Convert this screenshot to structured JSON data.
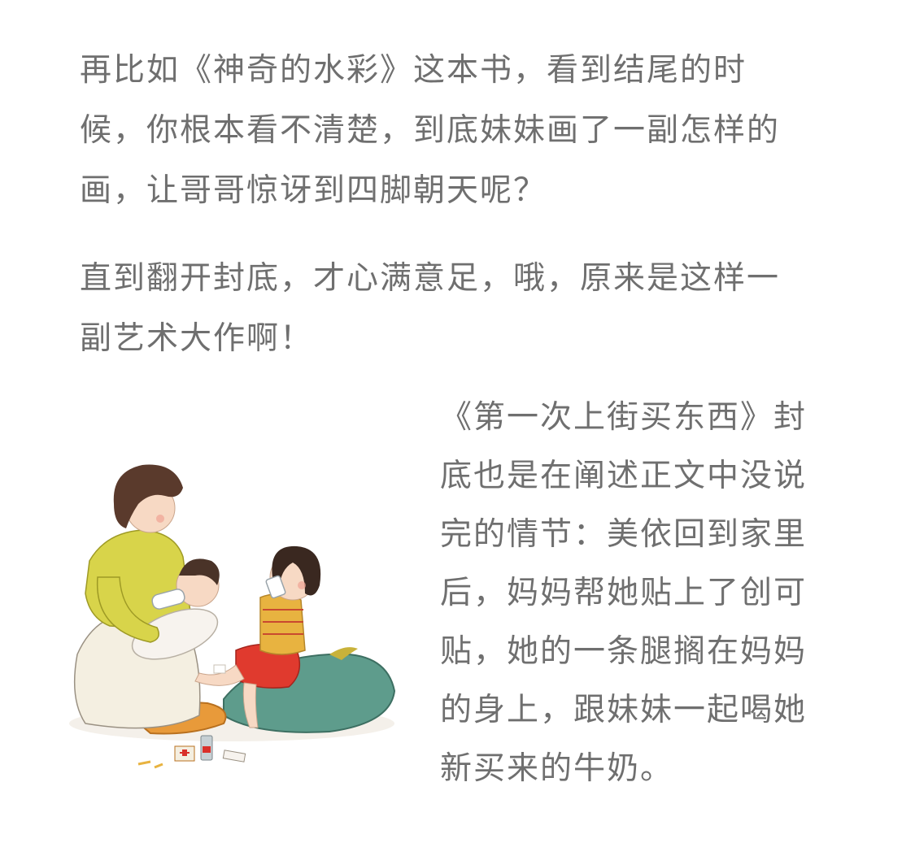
{
  "paragraph1": {
    "lines": [
      "再比如《神奇的水彩》这本书，看到结尾的时",
      "候，你根本看不清楚，到底妹妹画了一副怎样的",
      "画，让哥哥惊讶到四脚朝天呢？"
    ]
  },
  "paragraph2": {
    "lines": [
      "直到翻开封底，才心满意足，哦，原来是这样一",
      "副艺术大作啊！"
    ]
  },
  "caption": {
    "lines": [
      "《第一次上街买东西》封",
      "底也是在阐述正文中没说",
      "完的情节：美依回到家里",
      "后，妈妈帮她贴上了创可",
      "贴，她的一条腿搁在妈妈",
      "的身上，跟妹妹一起喝她",
      "新买来的牛奶。"
    ]
  },
  "illustration": {
    "icon": "mother-children-drinking-milk-illustration",
    "colors": {
      "mother_sweater": "#d8d44a",
      "mother_hair": "#5a3a2c",
      "skin": "#f7d9c4",
      "apron": "#f4efe1",
      "baby_clothes": "#f7f3ee",
      "girl_skirt": "#e03a2e",
      "girl_sweater": "#e8b340",
      "cushion_green": "#5e9c8c",
      "cushion_orange": "#e89a3a"
    }
  }
}
